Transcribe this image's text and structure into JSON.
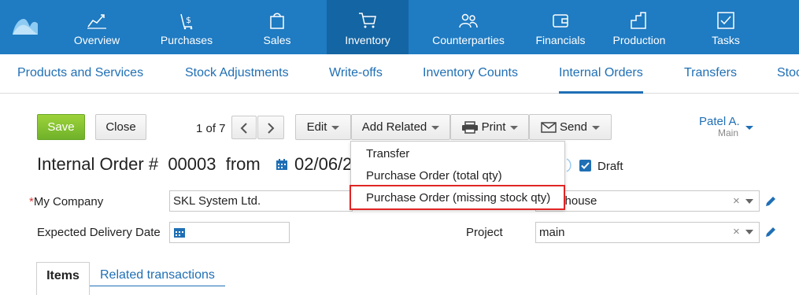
{
  "topnav": {
    "items": [
      {
        "label": "Overview"
      },
      {
        "label": "Purchases"
      },
      {
        "label": "Sales"
      },
      {
        "label": "Inventory"
      },
      {
        "label": "Counterparties"
      },
      {
        "label": "Financials"
      },
      {
        "label": "Production"
      },
      {
        "label": "Tasks"
      }
    ],
    "active": "Inventory"
  },
  "subnav": {
    "items": [
      {
        "label": "Products and Services"
      },
      {
        "label": "Stock Adjustments"
      },
      {
        "label": "Write-offs"
      },
      {
        "label": "Inventory Counts"
      },
      {
        "label": "Internal Orders"
      },
      {
        "label": "Transfers"
      },
      {
        "label": "Stoc"
      }
    ],
    "active": "Internal Orders"
  },
  "toolbar": {
    "save": "Save",
    "close": "Close",
    "pager": "1 of 7",
    "edit": "Edit",
    "add_related": "Add Related",
    "print": "Print",
    "send": "Send"
  },
  "user": {
    "name": "Patel A.",
    "role": "Main"
  },
  "doc": {
    "title": "Internal Order #",
    "number": "00003",
    "from": "from",
    "date": "02/06/2",
    "draft_label": "Draft",
    "draft_checked": true
  },
  "form": {
    "company_label": "My Company",
    "company_value": "SKL System Ltd.",
    "warehouse_value": "warehouse",
    "delivery_label": "Expected Delivery Date",
    "delivery_value": "",
    "project_label": "Project",
    "project_value": "main"
  },
  "menu": {
    "items": [
      {
        "label": "Transfer"
      },
      {
        "label": "Purchase Order (total qty)"
      },
      {
        "label": "Purchase Order (missing stock qty)"
      }
    ],
    "highlighted": "Purchase Order (missing stock qty)"
  },
  "tabs": {
    "items": "Items",
    "related": "Related transactions"
  },
  "colors": {
    "nav_bg": "#1f7bc2",
    "nav_active": "#1465a3",
    "link": "#1f6fb5",
    "save_green": "#7cbd2c",
    "highlight_red": "#e02424"
  }
}
